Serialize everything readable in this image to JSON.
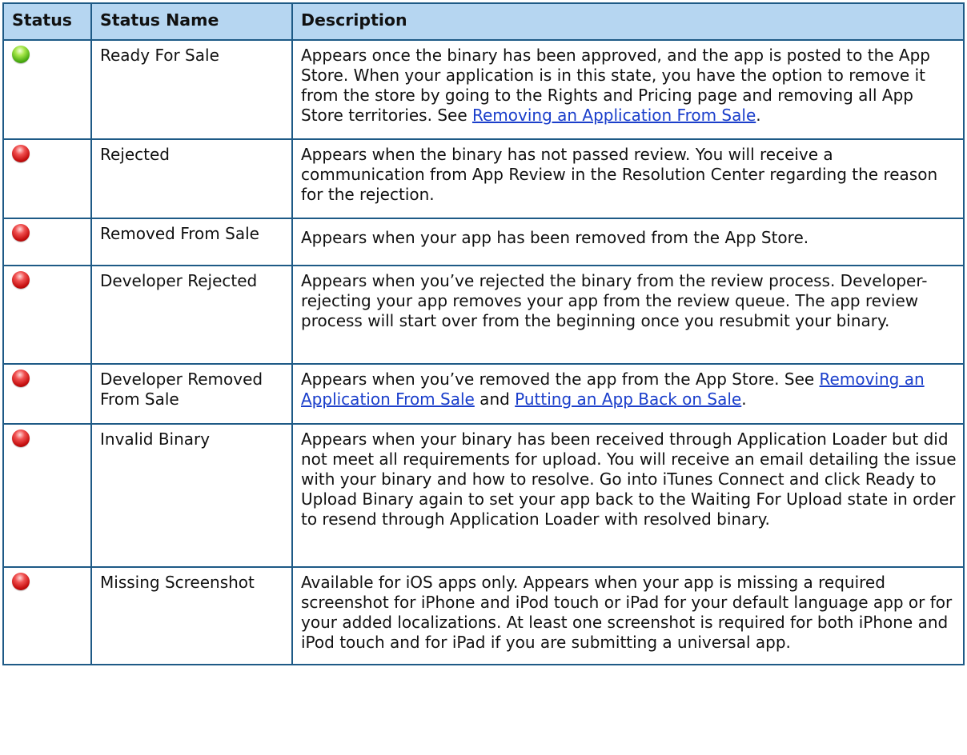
{
  "headers": {
    "status": "Status",
    "name": "Status Name",
    "description": "Description"
  },
  "colors": {
    "border": "#1e5a86",
    "header_bg": "#b6d6f1",
    "link": "#1a3ecb",
    "green": "#46a80e",
    "red": "#c40e0e"
  },
  "rows": [
    {
      "indicator": "green",
      "name": "Ready For Sale",
      "desc": {
        "text": "Appears once the binary has been approved, and the app is posted to the App Store. When your application is in this state, you have the option to remove it from the store by going to the Rights and Pricing page and removing all App Store territories. See ",
        "link1": "Removing an Application From Sale",
        "end": "."
      }
    },
    {
      "indicator": "red",
      "name": "Rejected",
      "desc": {
        "text": "Appears when the binary has not passed review. You will receive a communication from App Review in the Resolution Center regarding the reason for the rejection."
      }
    },
    {
      "indicator": "red",
      "name": "Removed From Sale",
      "desc": {
        "text": "Appears when your app has been removed from the App Store."
      }
    },
    {
      "indicator": "red",
      "name": "Developer Rejected",
      "desc": {
        "text": "Appears when you’ve rejected the binary from the review process. Developer-rejecting your app removes your app from the review queue. The app review process will start over from the beginning once you resubmit your binary."
      }
    },
    {
      "indicator": "red",
      "name": "Developer Removed From Sale",
      "desc": {
        "text": "Appears when you’ve removed the app from the App Store. See ",
        "link1": "Removing an Application From Sale",
        "mid": " and ",
        "link2": "Putting an App Back on Sale",
        "end": "."
      }
    },
    {
      "indicator": "red",
      "name": "Invalid Binary",
      "desc": {
        "text": "Appears when your binary has been received through Application Loader but did not meet all requirements for upload. You will receive an email detailing the issue with your binary and how to resolve. Go into iTunes Connect and click Ready to Upload Binary again to set your app back to the Waiting For Upload state in order to resend through Application Loader with resolved binary."
      }
    },
    {
      "indicator": "red",
      "name": "Missing Screenshot",
      "desc": {
        "text": "Available for iOS apps only. Appears when your app is missing a required screenshot for iPhone and iPod touch or iPad for your default language app or for your added localizations.  At least one screenshot is required for both iPhone and iPod touch and for iPad if you are submitting a universal app."
      }
    }
  ]
}
